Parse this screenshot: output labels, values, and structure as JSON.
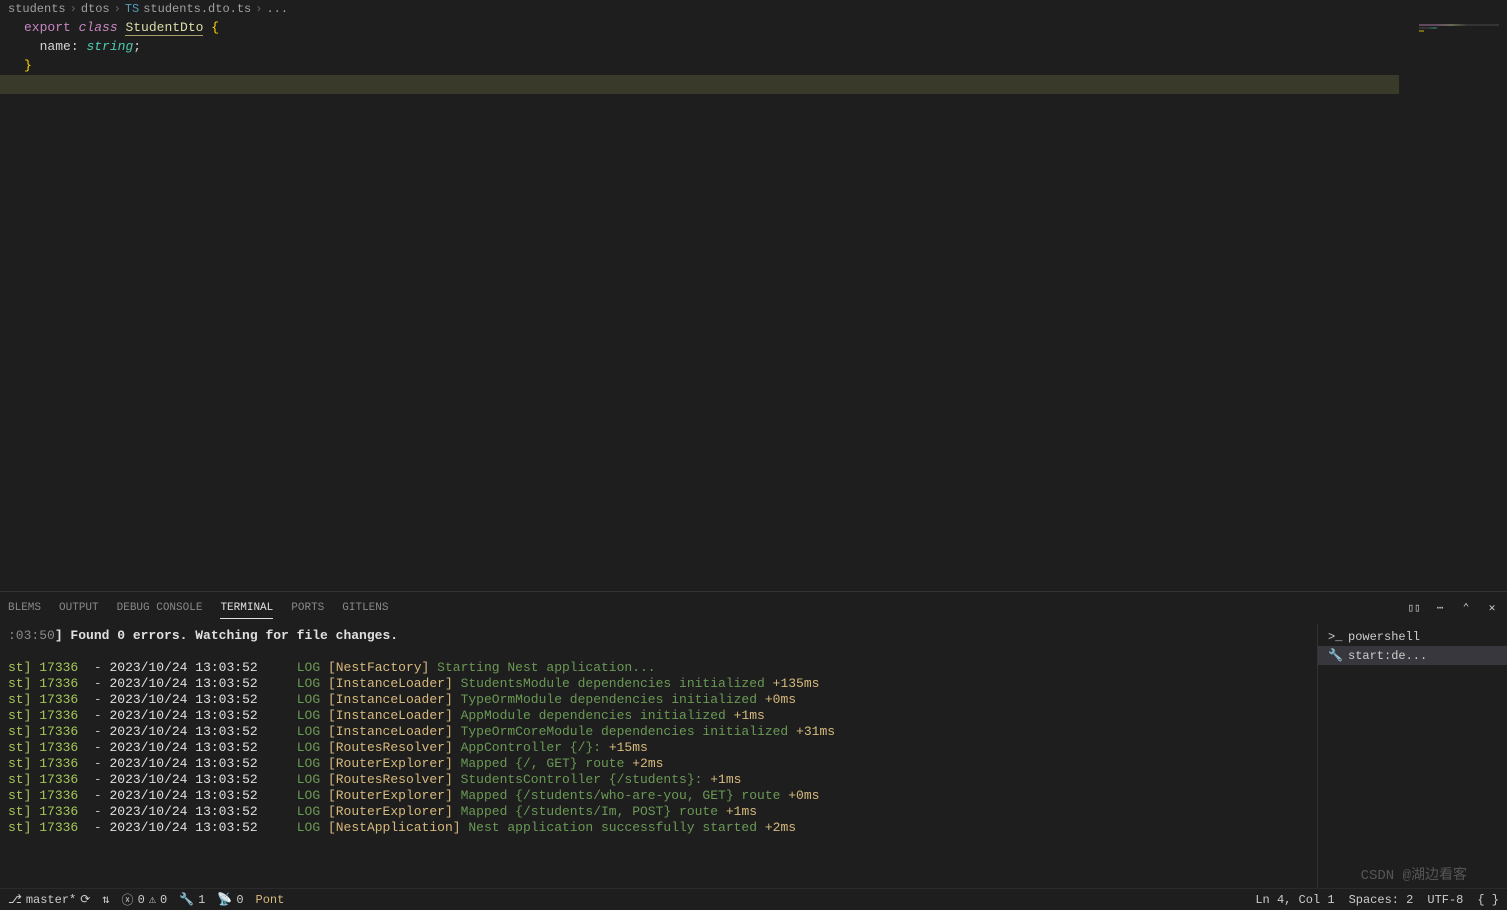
{
  "breadcrumb": [
    "students",
    "dtos",
    "students.dto.ts",
    "..."
  ],
  "code": {
    "line1": {
      "export": "export",
      "class": "class",
      "name": "StudentDto",
      "brace": "{"
    },
    "line2": {
      "indent": "  ",
      "prop": "name",
      "colon": ":",
      "type": "string",
      "semi": ";"
    },
    "line3": {
      "brace": "}"
    }
  },
  "panel": {
    "tabs": {
      "problems": "BLEMS",
      "output": "OUTPUT",
      "debug": "DEBUG CONSOLE",
      "terminal": "TERMINAL",
      "ports": "PORTS",
      "gitlens": "GITLENS"
    }
  },
  "terminal": {
    "watch": {
      "time": ":03:50",
      "text": "] Found 0 errors. Watching for file changes."
    },
    "logs": [
      {
        "st": "st]",
        "pid": "17336",
        "dash": "-",
        "date": "2023/10/24 13:03:52",
        "lvl": "LOG",
        "src": "[NestFactory]",
        "msg": "Starting Nest application...",
        "ms": ""
      },
      {
        "st": "st]",
        "pid": "17336",
        "dash": "-",
        "date": "2023/10/24 13:03:52",
        "lvl": "LOG",
        "src": "[InstanceLoader]",
        "msg": "StudentsModule dependencies initialized",
        "ms": "+135ms"
      },
      {
        "st": "st]",
        "pid": "17336",
        "dash": "-",
        "date": "2023/10/24 13:03:52",
        "lvl": "LOG",
        "src": "[InstanceLoader]",
        "msg": "TypeOrmModule dependencies initialized",
        "ms": "+0ms"
      },
      {
        "st": "st]",
        "pid": "17336",
        "dash": "-",
        "date": "2023/10/24 13:03:52",
        "lvl": "LOG",
        "src": "[InstanceLoader]",
        "msg": "AppModule dependencies initialized",
        "ms": "+1ms"
      },
      {
        "st": "st]",
        "pid": "17336",
        "dash": "-",
        "date": "2023/10/24 13:03:52",
        "lvl": "LOG",
        "src": "[InstanceLoader]",
        "msg": "TypeOrmCoreModule dependencies initialized",
        "ms": "+31ms"
      },
      {
        "st": "st]",
        "pid": "17336",
        "dash": "-",
        "date": "2023/10/24 13:03:52",
        "lvl": "LOG",
        "src": "[RoutesResolver]",
        "msg": "AppController {/}:",
        "ms": "+15ms"
      },
      {
        "st": "st]",
        "pid": "17336",
        "dash": "-",
        "date": "2023/10/24 13:03:52",
        "lvl": "LOG",
        "src": "[RouterExplorer]",
        "msg": "Mapped {/, GET} route",
        "ms": "+2ms"
      },
      {
        "st": "st]",
        "pid": "17336",
        "dash": "-",
        "date": "2023/10/24 13:03:52",
        "lvl": "LOG",
        "src": "[RoutesResolver]",
        "msg": "StudentsController {/students}:",
        "ms": "+1ms"
      },
      {
        "st": "st]",
        "pid": "17336",
        "dash": "-",
        "date": "2023/10/24 13:03:52",
        "lvl": "LOG",
        "src": "[RouterExplorer]",
        "msg": "Mapped {/students/who-are-you, GET} route",
        "ms": "+0ms"
      },
      {
        "st": "st]",
        "pid": "17336",
        "dash": "-",
        "date": "2023/10/24 13:03:52",
        "lvl": "LOG",
        "src": "[RouterExplorer]",
        "msg": "Mapped {/students/Im, POST} route",
        "ms": "+1ms"
      },
      {
        "st": "st]",
        "pid": "17336",
        "dash": "-",
        "date": "2023/10/24 13:03:52",
        "lvl": "LOG",
        "src": "[NestApplication]",
        "msg": "Nest application successfully started",
        "ms": "+2ms"
      }
    ],
    "sidebar": {
      "powershell": "powershell",
      "startdev": "start:de..."
    }
  },
  "statusbar": {
    "branch": "master*",
    "errors": "0",
    "warnings": "0",
    "tools": "1",
    "radio": "0",
    "pont": "Pont",
    "pos": "Ln 4, Col 1",
    "spaces": "Spaces: 2",
    "encoding": "UTF-8",
    "lang": "{ }"
  },
  "watermark": "CSDN @湖边看客",
  "icons": {
    "terminal": "▷",
    "wrench": "🔧",
    "branch": "⎇",
    "sync": "⟳",
    "error": "ⓧ",
    "warning": "⚠",
    "radio": "📡",
    "tools": "🔧",
    "split": "▯▯",
    "more": "⋯",
    "chevup": "⌃",
    "close": "✕",
    "psicon": ">_",
    "spanner": "✕"
  }
}
